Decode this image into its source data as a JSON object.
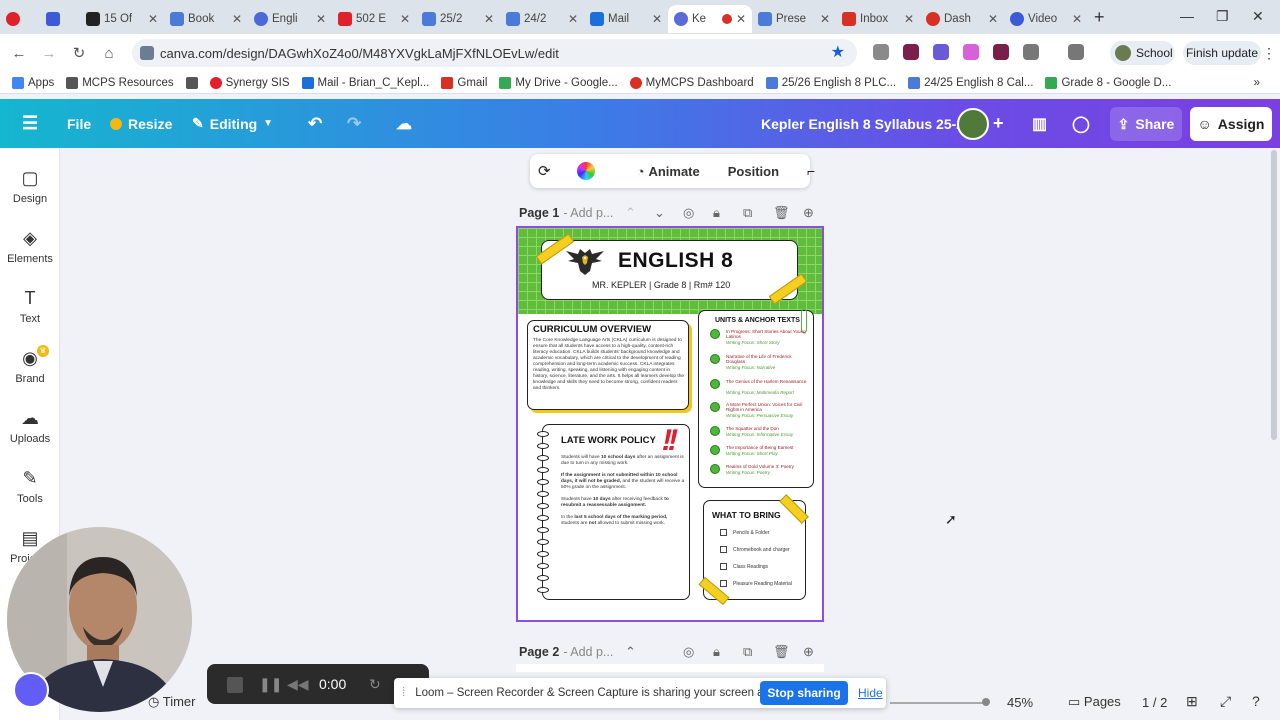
{
  "browser": {
    "tabs": [
      {
        "title": "15 Of",
        "color": "#222222"
      },
      {
        "title": "Book",
        "color": "#4a7bd8"
      },
      {
        "title": "Engli",
        "color": "#4a6ad8"
      },
      {
        "title": "502 E",
        "color": "#e0202a"
      },
      {
        "title": "25/2",
        "color": "#4a7bd8"
      },
      {
        "title": "24/2",
        "color": "#4a7bd8"
      },
      {
        "title": "Mail",
        "color": "#1a6fd8"
      },
      {
        "title": "Ke",
        "color": "#5a6ad8"
      },
      {
        "title": "Prese",
        "color": "#4a7bd8"
      },
      {
        "title": "Inbox",
        "color": "#d93025"
      },
      {
        "title": "Dash",
        "color": "#d93025"
      },
      {
        "title": "Video",
        "color": "#3b5bd6"
      }
    ],
    "url": "canva.com/design/DAGwhXoZ4o0/M48YXVgkLaMjFXfNLOEvLw/edit",
    "profile_label": "School",
    "finish_update": "Finish update",
    "bookmarks": [
      {
        "label": "Apps",
        "color": "#4285f4"
      },
      {
        "label": "MCPS Resources",
        "color": "#555555"
      },
      {
        "label": "",
        "color": "#555555"
      },
      {
        "label": "Synergy SIS",
        "color": "#e0202a"
      },
      {
        "label": "Mail - Brian_C_Kepl...",
        "color": "#1a6fd8"
      },
      {
        "label": "Gmail",
        "color": "#d93025"
      },
      {
        "label": "My Drive - Google...",
        "color": "#34a853"
      },
      {
        "label": "MyMCPS Dashboard",
        "color": "#d93025"
      },
      {
        "label": "25/26 English 8 PLC...",
        "color": "#4a7bd8"
      },
      {
        "label": "24/25 English 8 Cal...",
        "color": "#4a7bd8"
      },
      {
        "label": "Grade 8 - Google D...",
        "color": "#34a853"
      }
    ]
  },
  "canva": {
    "menu": {
      "file": "File",
      "resize": "Resize",
      "editing": "Editing"
    },
    "doc_title": "Kepler English 8 Syllabus 25-26",
    "share": "Share",
    "assign": "Assign",
    "sidebar": [
      {
        "label": "Design",
        "icon": "▢"
      },
      {
        "label": "Elements",
        "icon": "◈"
      },
      {
        "label": "Text",
        "icon": "T"
      },
      {
        "label": "Brand",
        "icon": "◉"
      },
      {
        "label": "Uploads",
        "icon": "☁"
      },
      {
        "label": "Tools",
        "icon": "✎"
      },
      {
        "label": "Projects",
        "icon": "▤"
      }
    ],
    "float_toolbar": {
      "animate": "Animate",
      "position": "Position"
    },
    "page1": {
      "label": "Page 1",
      "add_title": "- Add p..."
    },
    "page2": {
      "label": "Page 2",
      "add_title": "- Add p..."
    },
    "timer": "Timer",
    "zoom": "45%",
    "pages_label": "Pages",
    "page_count": "1 / 2"
  },
  "syllabus": {
    "title": "ENGLISH 8",
    "subtitle": "MR. KEPLER   | Grade 8 | Rm# 120",
    "overview_heading": "CURRICULUM OVERVIEW",
    "overview_text": "The Core Knowledge Language Arts (CKLA) curriculum is designed to ensure that all students have access to a high-quality, content-rich literacy education. CKLA builds students' background knowledge and academic vocabulary, which are critical to the development of reading comprehension and long-term academic success. CKLA integrates reading, writing, speaking, and listening with engaging content in history, science, literature, and the arts. It helps all learners develop the knowledge and skills they need to become strong, confident readers and thinkers.",
    "units_heading": "UNITS & ANCHOR TEXTS",
    "units": [
      {
        "title": "In Progress: Short Stories About Young Latinos",
        "focus": "Writing Focus: Short Story"
      },
      {
        "title": "Narrative of the Life of Frederick Douglass",
        "focus": "Writing Focus: Narrative"
      },
      {
        "title": "The Genius of the Harlem Renaissance",
        "focus": "Writing Focus: Multimedia Report"
      },
      {
        "title": "A More Perfect Union: Voices for Civil Rights in America",
        "focus": "Writing Focus: Persuasive Essay"
      },
      {
        "title": "The Squatter and the Don",
        "focus": "Writing Focus: Informative Essay"
      },
      {
        "title": "The Importance of Being Earnest",
        "focus": "Writing Focus: Short Play"
      },
      {
        "title": "Realms of Gold Volume 3: Poetry",
        "focus": "Writing Focus: Poetry"
      }
    ],
    "late_heading": "LATE WORK POLICY",
    "late_p1_a": "Students will have ",
    "late_p1_b": "10 school days",
    "late_p1_c": " after an assignment is due to turn in any missing work.",
    "late_p2_a": "If the assignment is not submitted within 10 school days, it will not be graded,",
    "late_p2_b": " and the student will receive a 50% grade on the assignment.",
    "late_p3_a": "Students have ",
    "late_p3_b": "10 days",
    "late_p3_c": " after receiving feedback ",
    "late_p3_d": "to resubmit a reassessable assignment.",
    "late_p4_a": "In the ",
    "late_p4_b": "last 5 school days of the marking period,",
    "late_p4_c": " students are ",
    "late_p4_d": "not",
    "late_p4_e": " allowed to submit missing work.",
    "exclaim": "!!",
    "bring_heading": "WHAT TO BRING",
    "bring_items": [
      "Pencils & Folder",
      "Chromebook and charger",
      "Class Readings",
      "Pleasure Reading Material"
    ]
  },
  "loom": {
    "message": "Loom – Screen Recorder & Screen Capture is sharing your screen and audio.",
    "stop": "Stop sharing",
    "hide": "Hide",
    "time": "0:00"
  }
}
